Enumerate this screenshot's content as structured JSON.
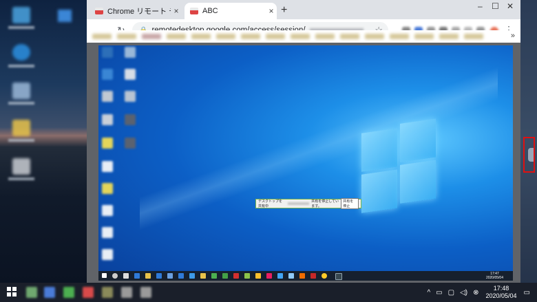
{
  "browser": {
    "tabs": [
      {
        "label": "Chrome リモート デスクトップ",
        "close": "×"
      },
      {
        "label": "ABC",
        "close": "×"
      }
    ],
    "new_tab": "+",
    "window_controls": {
      "minimize": "–",
      "maximize": "☐",
      "close": "✕"
    },
    "address": {
      "url": "remotedesktop.google.com/access/session/"
    },
    "more_bookmarks": "»"
  },
  "remote": {
    "infobar": {
      "text": "デスクトップを共有中",
      "suffix": "共有を停止しています。",
      "button": "共有を停止"
    },
    "clock": {
      "time": "17:47",
      "date": "2020/05/04"
    }
  },
  "taskbar": {
    "clock": {
      "time": "17:48",
      "date": "2020/05/04"
    },
    "tray_icons": [
      "chevron-up-icon",
      "network-icon",
      "speaker-icon",
      "notification-icon"
    ]
  },
  "accent": {
    "highlight": "#e01010",
    "windows_blue": "#0c5fc6"
  }
}
